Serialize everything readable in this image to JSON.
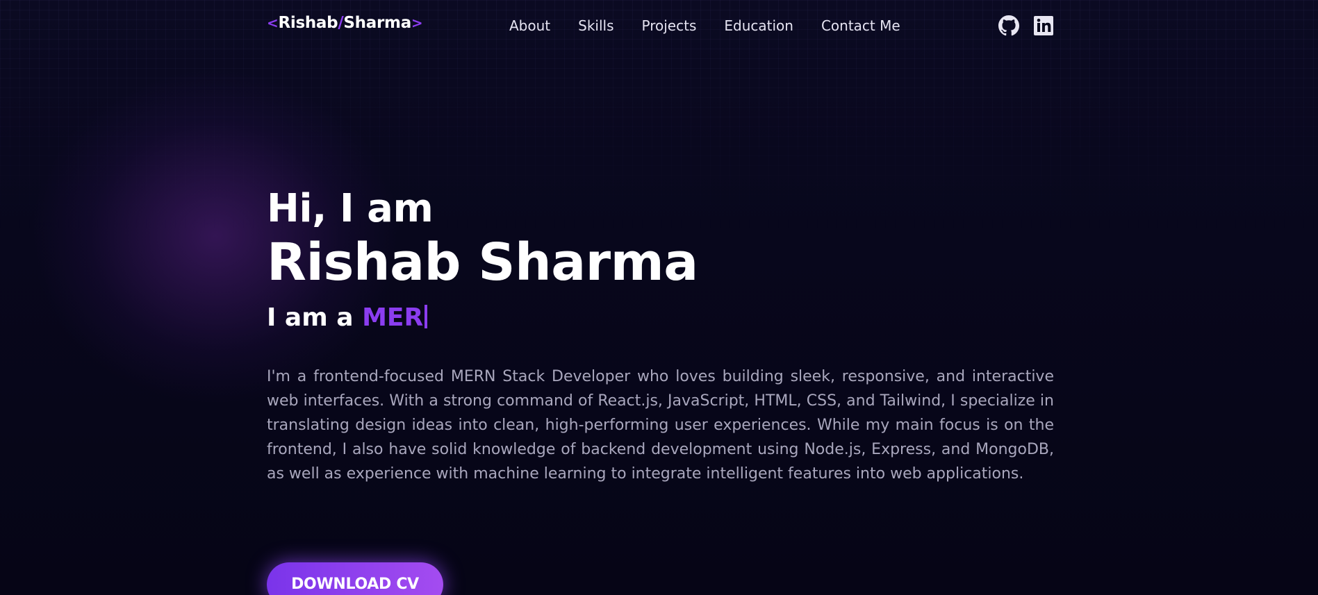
{
  "logo": {
    "open_bracket": "<",
    "first": "Rishab",
    "slash": "/",
    "last": "Sharma",
    "close_bracket": ">"
  },
  "nav": {
    "links": [
      "About",
      "Skills",
      "Projects",
      "Education",
      "Contact Me"
    ]
  },
  "social": {
    "icons": [
      "github-icon",
      "linkedin-icon"
    ]
  },
  "hero": {
    "greeting": "Hi, I am",
    "name": "Rishab Sharma",
    "role_prefix": "I am a",
    "role_typed": "MER",
    "bio": "I'm a frontend-focused MERN Stack Developer who loves building sleek, responsive, and interactive web interfaces. With a strong command of React.js, JavaScript, HTML, CSS, and Tailwind, I specialize in translating design ideas into clean, high-performing user experiences. While my main focus is on the frontend, I also have solid knowledge of backend development using Node.js, Express, and MongoDB, as well as experience with machine learning to integrate intelligent features into web applications.",
    "cv_button": "DOWNLOAD CV"
  },
  "colors": {
    "background": "#07061a",
    "accent": "#8b3df0",
    "text": "#ffffff",
    "muted_text": "#a9a7bd"
  }
}
